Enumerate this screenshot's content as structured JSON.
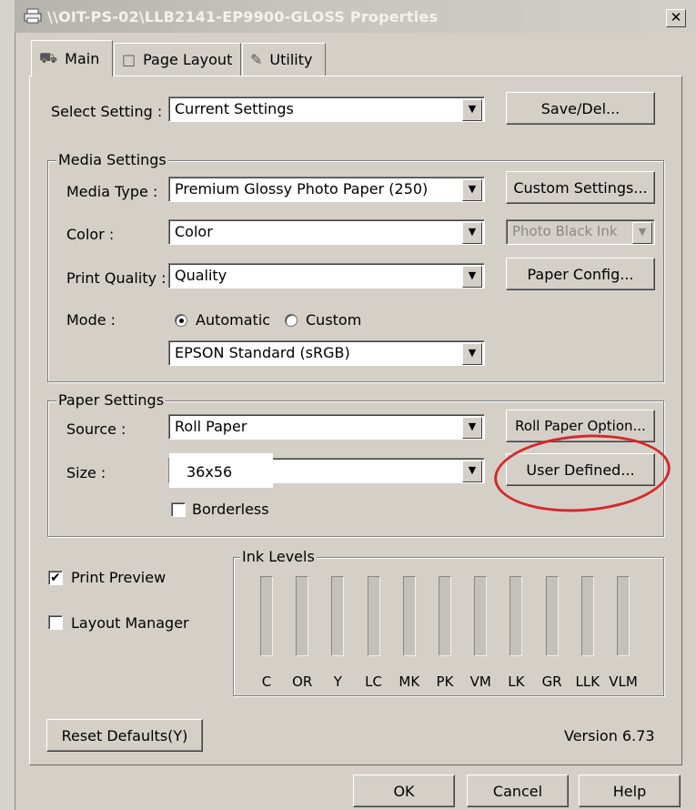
{
  "window": {
    "title": "\\\\OIT-PS-02\\LLB2141-EP9900-GLOSS Properties",
    "close_label": "✕"
  },
  "tabs": [
    {
      "label": "Main",
      "icon": "printer-icon",
      "active": true
    },
    {
      "label": "Page Layout",
      "icon": "page-icon",
      "active": false
    },
    {
      "label": "Utility",
      "icon": "wrench-icon",
      "active": false
    }
  ],
  "select_setting": {
    "label": "Select Setting :",
    "value": "Current Settings",
    "button": "Save/Del..."
  },
  "media": {
    "group_label": "Media Settings",
    "media_type_label": "Media Type :",
    "media_type_value": "Premium Glossy Photo Paper (250)",
    "custom_settings_button": "Custom Settings...",
    "color_label": "Color :",
    "color_value": "Color",
    "black_ink_value": "Photo Black Ink",
    "print_quality_label": "Print Quality :",
    "print_quality_value": "Quality",
    "paper_config_button": "Paper Config...",
    "mode_label": "Mode :",
    "mode_automatic": "Automatic",
    "mode_custom": "Custom",
    "mode_selected": "Automatic",
    "color_mode_value": "EPSON Standard (sRGB)"
  },
  "paper": {
    "group_label": "Paper Settings",
    "source_label": "Source :",
    "source_value": "Roll Paper",
    "roll_paper_option_button": "Roll Paper Option...",
    "size_label": "Size :",
    "size_value": "36x56",
    "user_defined_button": "User Defined...",
    "borderless_label": "Borderless",
    "borderless_checked": false
  },
  "options": {
    "print_preview_label": "Print Preview",
    "print_preview_checked": true,
    "layout_manager_label": "Layout Manager",
    "layout_manager_checked": false
  },
  "ink_levels": {
    "group_label": "Ink Levels",
    "inks": [
      "C",
      "OR",
      "Y",
      "LC",
      "MK",
      "PK",
      "VM",
      "LK",
      "GR",
      "LLK",
      "VLM"
    ]
  },
  "footer": {
    "reset_button": "Reset Defaults(Y)",
    "version": "Version 6.73"
  },
  "dialog_buttons": {
    "ok": "OK",
    "cancel": "Cancel",
    "help": "Help"
  },
  "colors": {
    "dialog_bg": "#d4d0c8",
    "annotation": "#d42a2a"
  }
}
